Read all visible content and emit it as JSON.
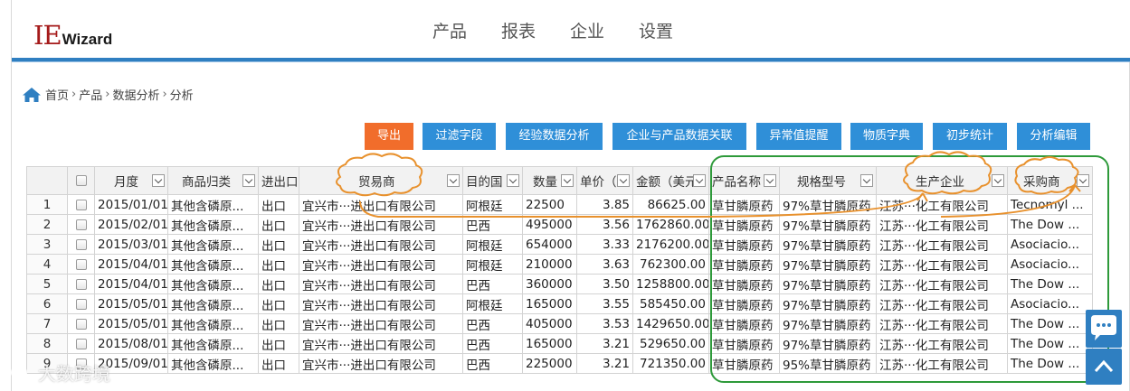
{
  "logo": {
    "ie": "IE",
    "wizard": "Wizard"
  },
  "nav": [
    "产品",
    "报表",
    "企业",
    "设置"
  ],
  "breadcrumb": [
    "首页",
    "产品",
    "数据分析",
    "分析"
  ],
  "toolbar": [
    "导出",
    "过滤字段",
    "经验数据分析",
    "企业与产品数据关联",
    "异常值提醒",
    "物质字典",
    "初步统计",
    "分析编辑"
  ],
  "columns": [
    "",
    "",
    "月度",
    "商品归类",
    "进出口",
    "贸易商",
    "目的国",
    "数量",
    "单价（",
    "金额（美元",
    "产品名称",
    "规格型号",
    "生产企业",
    "采购商"
  ],
  "rows": [
    [
      "1",
      "2015/01/01",
      "其他含磷原...",
      "出口",
      "宜兴市···进出口有限公司",
      "阿根廷",
      "22500",
      "3.85",
      "86625.00",
      "草甘膦原药",
      "97%草甘膦原药",
      "江苏···化工有限公司",
      "Tecnomyl ..."
    ],
    [
      "2",
      "2015/02/01",
      "其他含磷原...",
      "出口",
      "宜兴市···进出口有限公司",
      "巴西",
      "495000",
      "3.56",
      "1762860.00",
      "草甘膦原药",
      "97%草甘膦原药",
      "江苏···化工有限公司",
      "The Dow ..."
    ],
    [
      "3",
      "2015/03/01",
      "其他含磷原...",
      "出口",
      "宜兴市···进出口有限公司",
      "阿根廷",
      "654000",
      "3.33",
      "2176200.00",
      "草甘膦原药",
      "97%草甘膦原药",
      "江苏···化工有限公司",
      "Asociacio..."
    ],
    [
      "4",
      "2015/04/01",
      "其他含磷原...",
      "出口",
      "宜兴市···进出口有限公司",
      "阿根廷",
      "210000",
      "3.63",
      "762300.00",
      "草甘膦原药",
      "97%草甘膦原药",
      "江苏···化工有限公司",
      "Asociacio..."
    ],
    [
      "5",
      "2015/04/01",
      "其他含磷原...",
      "出口",
      "宜兴市···进出口有限公司",
      "巴西",
      "360000",
      "3.50",
      "1258800.00",
      "草甘膦原药",
      "97%草甘膦原药",
      "江苏···化工有限公司",
      "The Dow ..."
    ],
    [
      "6",
      "2015/05/01",
      "其他含磷原...",
      "出口",
      "宜兴市···进出口有限公司",
      "阿根廷",
      "165000",
      "3.55",
      "585450.00",
      "草甘膦原药",
      "97%草甘膦原药",
      "江苏···化工有限公司",
      "Asociacio..."
    ],
    [
      "7",
      "2015/05/01",
      "其他含磷原...",
      "出口",
      "宜兴市···进出口有限公司",
      "巴西",
      "405000",
      "3.53",
      "1429650.00",
      "草甘膦原药",
      "97%草甘膦原药",
      "江苏···化工有限公司",
      "The Dow ..."
    ],
    [
      "8",
      "2015/08/01",
      "其他含磷原...",
      "出口",
      "宜兴市···进出口有限公司",
      "巴西",
      "165000",
      "3.21",
      "529650.00",
      "草甘膦原药",
      "97%草甘膦原药",
      "江苏···化工有限公司",
      "The Dow ..."
    ],
    [
      "9",
      "2015/09/01",
      "其他含磷原...",
      "出口",
      "宜兴市···进出口有限公司",
      "巴西",
      "225000",
      "3.21",
      "721350.00",
      "草甘膦原药",
      "95%草甘膦原药",
      "江苏···化工有限公司",
      "The Dow ..."
    ]
  ],
  "watermark": "大数跨境",
  "colors": {
    "accent": "#2f7fc1",
    "export_button": "#f16d2b",
    "annotation_orange": "#e8912d",
    "annotation_green": "#2e9a3a"
  }
}
